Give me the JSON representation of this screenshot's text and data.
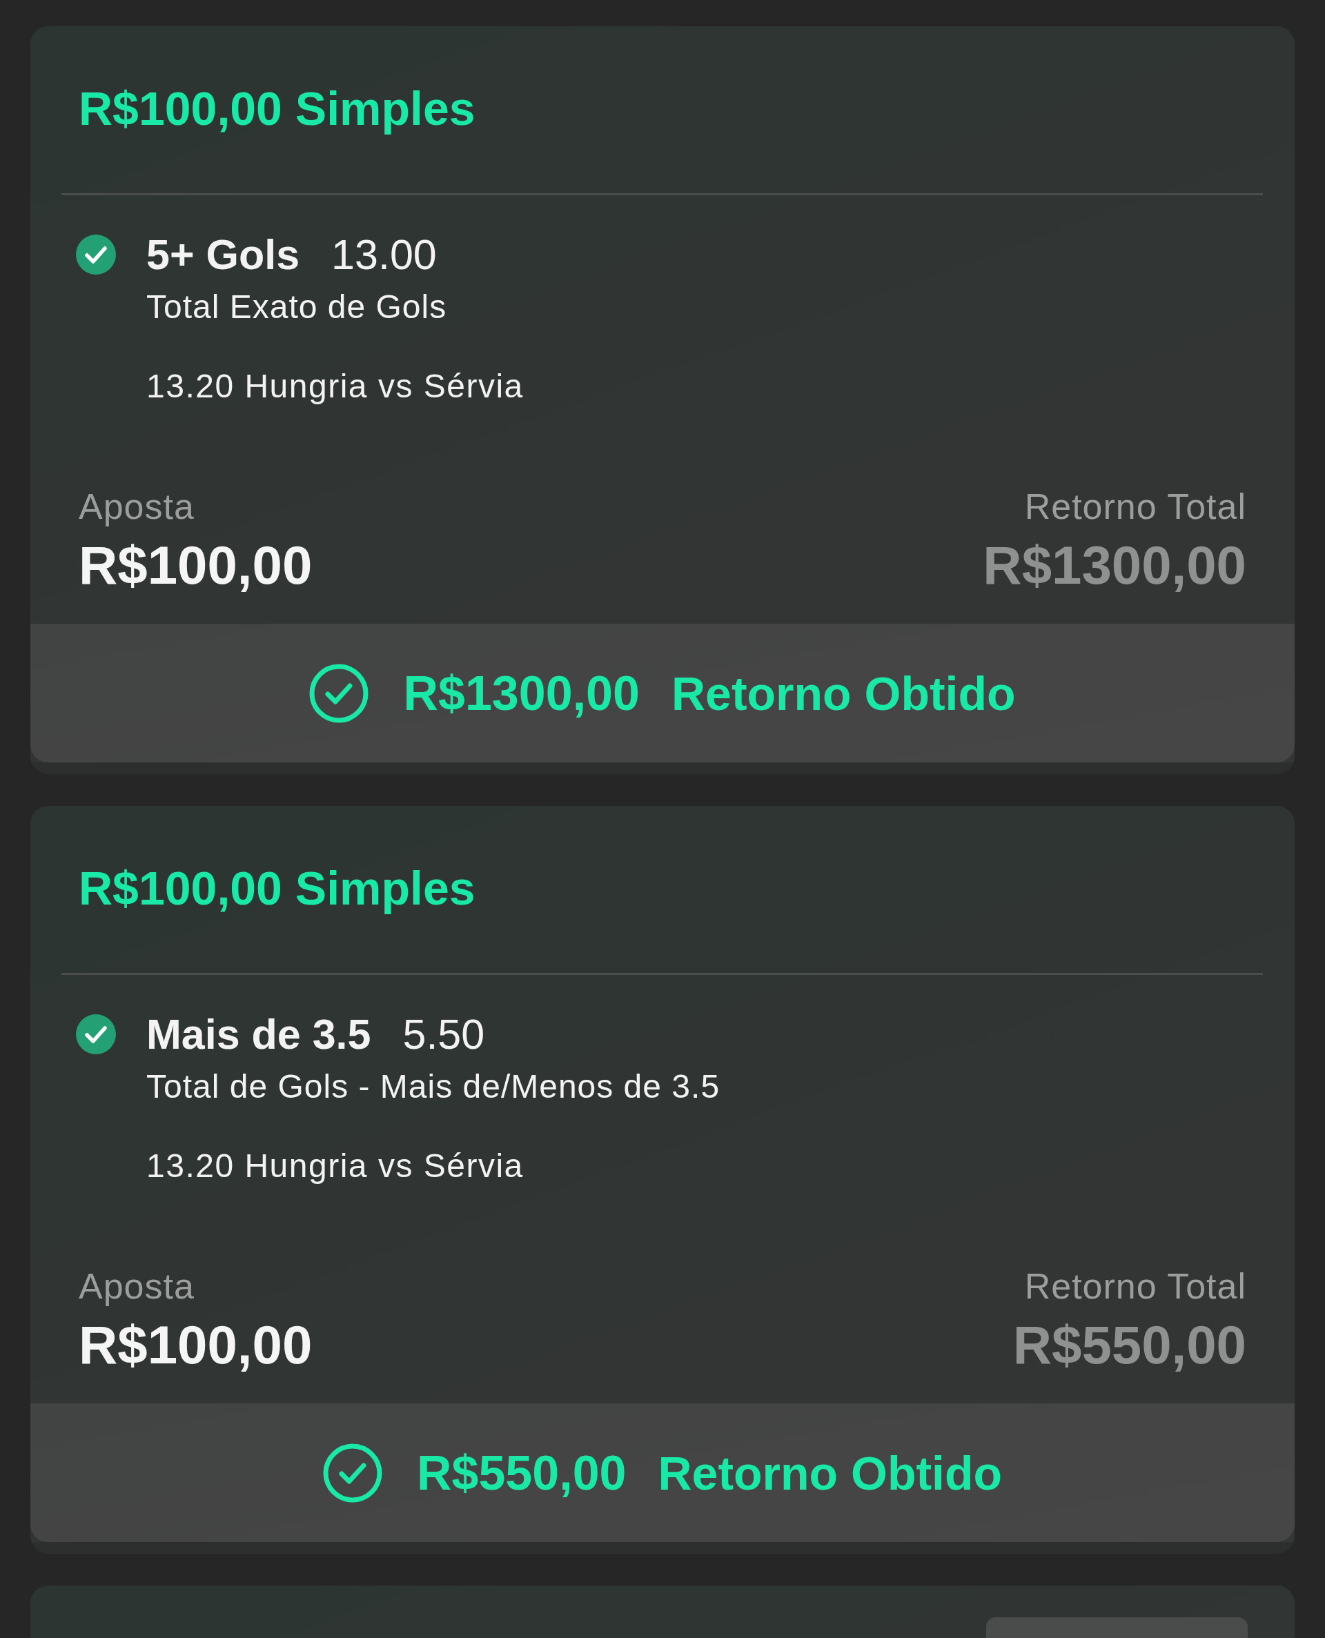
{
  "bets": [
    {
      "title": "R$100,00 Simples",
      "selection": {
        "won": true,
        "name": "5+ Gols",
        "odds": "13.00",
        "market": "Total Exato de Gols",
        "event": "13.20 Hungria vs Sérvia"
      },
      "stake": {
        "label": "Aposta",
        "value": "R$100,00"
      },
      "total_return": {
        "label": "Retorno Total",
        "value": "R$1300,00"
      },
      "result": {
        "amount": "R$1300,00",
        "label": "Retorno Obtido"
      }
    },
    {
      "title": "R$100,00 Simples",
      "selection": {
        "won": true,
        "name": "Mais de 3.5",
        "odds": "5.50",
        "market": "Total de Gols - Mais de/Menos de 3.5",
        "event": "13.20 Hungria vs Sérvia"
      },
      "stake": {
        "label": "Aposta",
        "value": "R$100,00"
      },
      "total_return": {
        "label": "Retorno Total",
        "value": "R$550,00"
      },
      "result": {
        "amount": "R$550,00",
        "label": "Retorno Obtido"
      }
    }
  ]
}
